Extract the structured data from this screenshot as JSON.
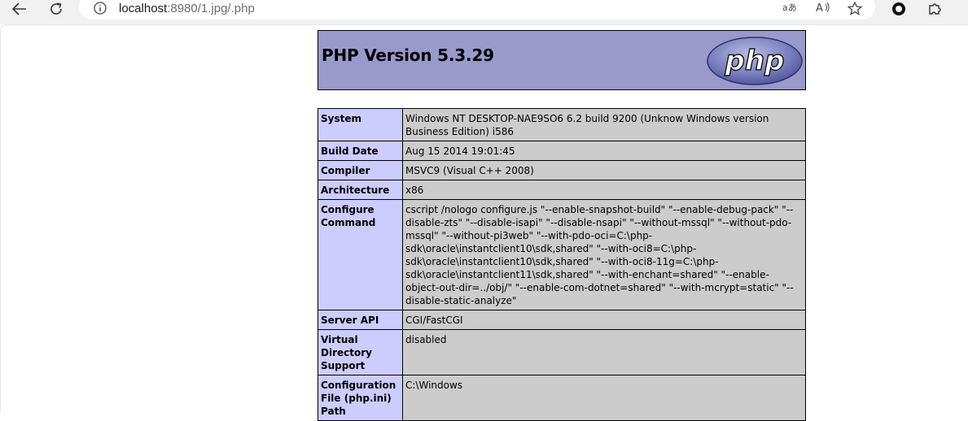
{
  "browser": {
    "url_host": "localhost",
    "url_rest": ":8980/1.jpg/.php",
    "icons": [
      "back-arrow-icon",
      "reload-icon",
      "info-icon",
      "read-aloud-icon",
      "text-size-icon",
      "favorite-star-icon",
      "profile-circle-icon",
      "extensions-puzzle-icon"
    ]
  },
  "header": {
    "title": "PHP Version 5.3.29",
    "logo_text": "php",
    "bg_color": "#9999cc"
  },
  "table": {
    "rows": [
      {
        "key": "System",
        "value": "Windows NT DESKTOP-NAE9SO6 6.2 build 9200 (Unknow Windows version Business Edition) i586"
      },
      {
        "key": "Build Date",
        "value": "Aug 15 2014 19:01:45"
      },
      {
        "key": "Compiler",
        "value": "MSVC9 (Visual C++ 2008)"
      },
      {
        "key": "Architecture",
        "value": "x86"
      },
      {
        "key": "Configure Command",
        "value": "cscript /nologo configure.js \"--enable-snapshot-build\" \"--enable-debug-pack\" \"--disable-zts\" \"--disable-isapi\" \"--disable-nsapi\" \"--without-mssql\" \"--without-pdo-mssql\" \"--without-pi3web\" \"--with-pdo-oci=C:\\php-sdk\\oracle\\instantclient10\\sdk,shared\" \"--with-oci8=C:\\php-sdk\\oracle\\instantclient10\\sdk,shared\" \"--with-oci8-11g=C:\\php-sdk\\oracle\\instantclient11\\sdk,shared\" \"--with-enchant=shared\" \"--enable-object-out-dir=../obj/\" \"--enable-com-dotnet=shared\" \"--with-mcrypt=static\" \"--disable-static-analyze\""
      },
      {
        "key": "Server API",
        "value": "CGI/FastCGI"
      },
      {
        "key": "Virtual Directory Support",
        "value": "disabled"
      },
      {
        "key": "Configuration File (php.ini) Path",
        "value": "C:\\Windows"
      }
    ],
    "key_color": "#ccccff",
    "value_color": "#cccccc"
  }
}
